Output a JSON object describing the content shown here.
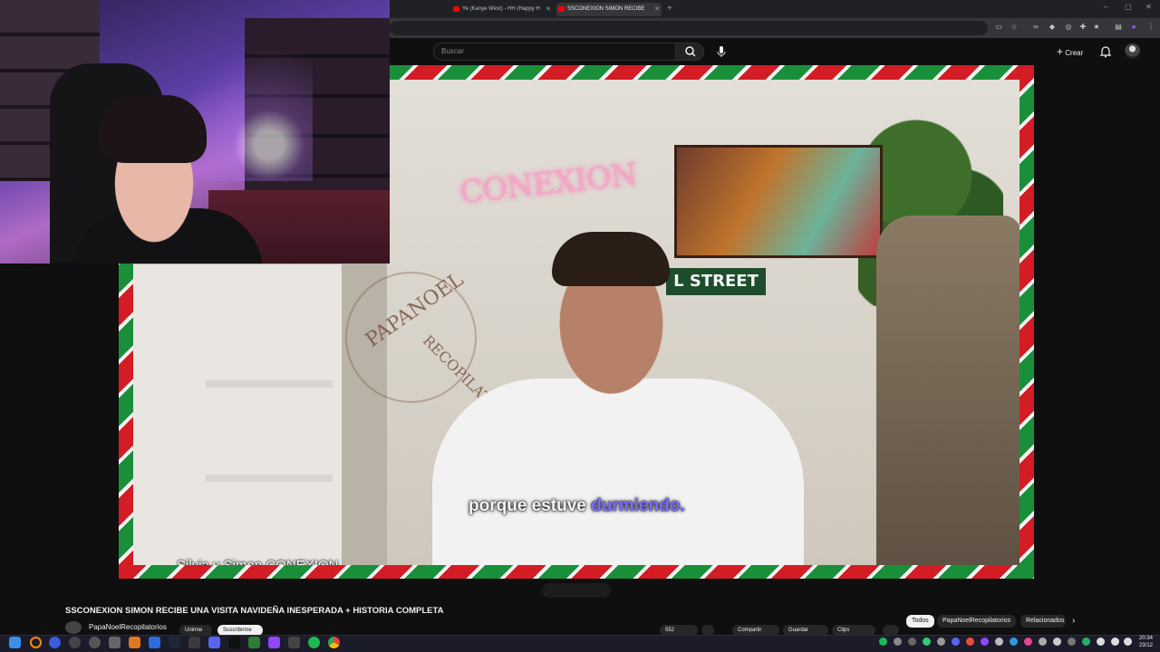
{
  "browser": {
    "tabs": [
      {
        "label": "Ye (Kanye West) - HH (Happy H",
        "active": false
      },
      {
        "label": "SSCONEXION SIMON RECIBE",
        "active": true
      }
    ],
    "new_tab": "+",
    "window_controls": [
      "–",
      "▢",
      "✕"
    ]
  },
  "youtube": {
    "search": {
      "placeholder": "Buscar"
    },
    "create_label": "Crear"
  },
  "video": {
    "subtitle_plain": "porque estuve ",
    "subtitle_highlight": "durmiendo.",
    "speaker_label": "Silvia y Simon CONEXION",
    "watermark_top": "PAPANOEL",
    "watermark_bottom": "RECOPILATORIOS",
    "neon_sign": "CONEXION",
    "street_sign": "L STREET"
  },
  "below_player": {
    "title": "SSCONEXION SIMON RECIBE UNA VISITA NAVIDEÑA INESPERADA + HISTORIA COMPLETA",
    "channel_name": "PapaNoelRecopilatorios",
    "chips": [
      "Unirme",
      "Suscribirme",
      "552",
      "Compartir",
      "Guardar",
      "Clips"
    ],
    "filters": [
      "Todos",
      "PapaNoelRecopilatorios",
      "Relacionados"
    ]
  },
  "taskbar": {
    "clock_time": "20:34",
    "clock_date": "23/12"
  },
  "colors": {
    "stripe_green": "#1a8f3a",
    "stripe_red": "#d31c24",
    "subtitle_highlight": "#7b6cff",
    "youtube_bg": "#0f0f0f"
  }
}
